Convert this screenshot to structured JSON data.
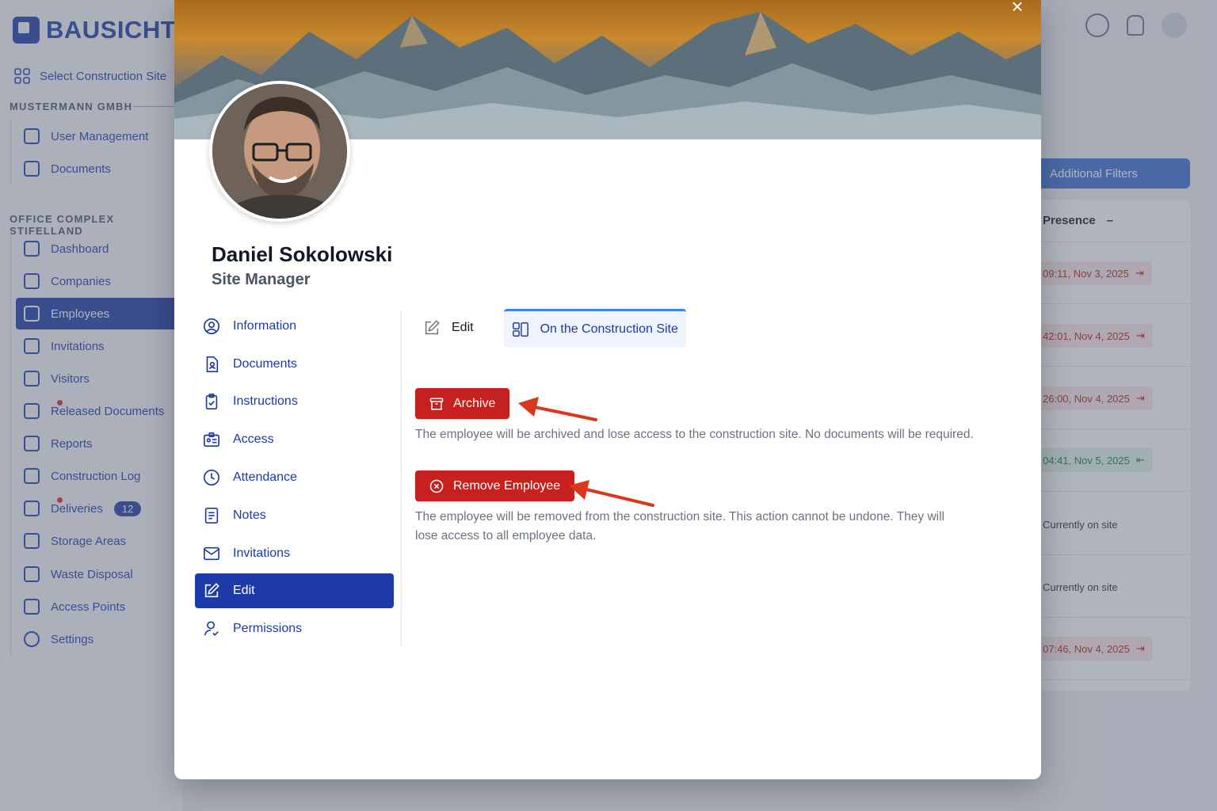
{
  "app": {
    "brand": "BAUSICHT",
    "select_site": "Select Construction Site",
    "org_section": "MUSTERMANN GMBH",
    "org_items": [
      "User Management",
      "Documents"
    ],
    "site_section": "OFFICE COMPLEX STIFELLAND",
    "site_items": [
      "Dashboard",
      "Companies",
      "Employees",
      "Invitations",
      "Visitors",
      "Released Documents",
      "Reports",
      "Construction Log",
      "Deliveries",
      "Storage Areas",
      "Waste Disposal",
      "Access Points",
      "Settings"
    ],
    "deliveries_badge": "12",
    "filters_button": "Additional Filters",
    "presence_header": "Presence",
    "presence_sort": "–",
    "presence_cells": [
      {
        "text": "09:11, Nov 3, 2025",
        "status": "out"
      },
      {
        "text": "42:01, Nov 4, 2025",
        "status": "out"
      },
      {
        "text": "26:00, Nov 4, 2025",
        "status": "out"
      },
      {
        "text": "04:41, Nov 5, 2025",
        "status": "in"
      },
      {
        "text": "Currently on site",
        "status": "on"
      },
      {
        "text": "Currently on site",
        "status": "on"
      },
      {
        "text": "07:46, Nov 4, 2025",
        "status": "out"
      }
    ]
  },
  "modal": {
    "close": "×",
    "name": "Daniel Sokolowski",
    "role": "Site Manager",
    "menu": [
      "Information",
      "Documents",
      "Instructions",
      "Access",
      "Attendance",
      "Notes",
      "Invitations",
      "Edit",
      "Permissions"
    ],
    "active_menu": "Edit",
    "tabs": [
      "Edit",
      "On the Construction Site"
    ],
    "active_tab": "On the Construction Site",
    "archive_button": "Archive",
    "archive_desc": "The employee will be archived and lose access to the construction site. No documents will be required.",
    "remove_button": "Remove Employee",
    "remove_desc_line1": "The employee will be removed from the construction site. This action cannot be undone. They will",
    "remove_desc_line2": "lose access to all employee data."
  },
  "colors": {
    "brand": "#1e3aa8",
    "danger": "#c4211f",
    "annotation_arrow": "#d9381e",
    "tab_accent": "#3b82f6"
  }
}
